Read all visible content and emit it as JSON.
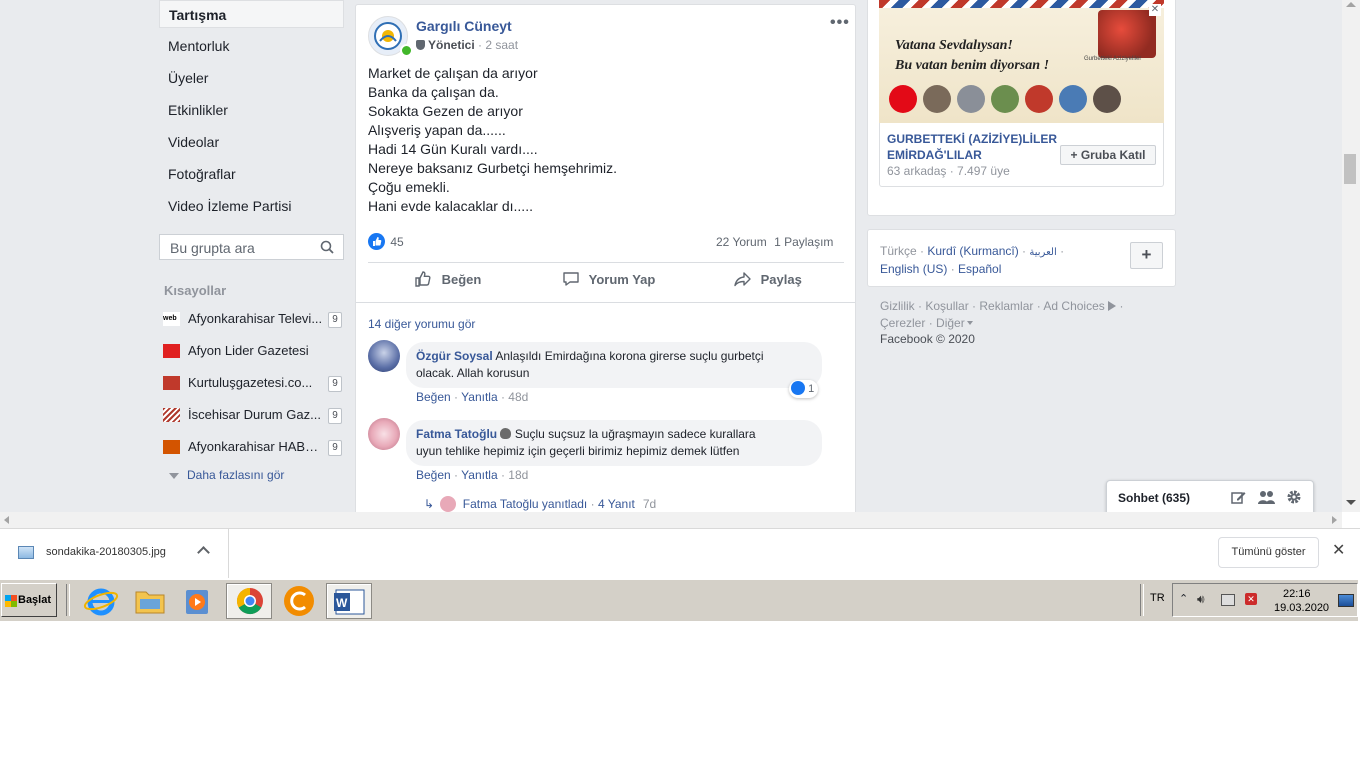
{
  "left_nav": {
    "items": [
      "Tartışma",
      "Mentorluk",
      "Üyeler",
      "Etkinlikler",
      "Videolar",
      "Fotoğraflar",
      "Video İzleme Partisi"
    ],
    "search_placeholder": "Bu grupta ara",
    "shortcuts_title": "Kısayollar",
    "shortcuts": [
      {
        "label": "Afyonkarahisar Televi...",
        "badge": "9",
        "color": "#000000"
      },
      {
        "label": "Afyon Lider Gazetesi",
        "badge": "9",
        "color": "#e02020"
      },
      {
        "label": "Kurtuluşgazetesi.co...",
        "badge": "9",
        "color": "#c0392b"
      },
      {
        "label": "İscehisar Durum Gaz...",
        "badge": "9",
        "color": "#b03a2e"
      },
      {
        "label": "Afyonkarahisar HABER",
        "badge": "9",
        "color": "#d35400"
      }
    ],
    "see_more": "Daha fazlasını gör"
  },
  "post": {
    "author": "Gargılı Cüneyt",
    "role": "Yönetici",
    "time": "2 saat",
    "lines": [
      "Market de çalışan da arıyor",
      "Banka da çalışan da.",
      "Sokakta Gezen de arıyor",
      "Alışveriş yapan da......",
      "Hadi 14 Gün Kuralı vardı....",
      "Nereye baksanız Gurbetçi hemşehrimiz.",
      "Çoğu emekli.",
      "Hani evde kalacaklar dı....."
    ],
    "likes": "45",
    "comments_count": "22 Yorum",
    "shares_count": "1 Paylaşım",
    "actions": {
      "like": "Beğen",
      "comment": "Yorum Yap",
      "share": "Paylaş"
    },
    "more_comments": "14 diğer yorumu gör",
    "comments": [
      {
        "author": "Özgür Soysal",
        "text1": "Anlaşıldı Emirdağına korona girerse suçlu gurbetçi",
        "text2": "olacak. Allah korusun",
        "like": "Beğen",
        "reply": "Yanıtla",
        "time": "48d",
        "reactions": "1"
      },
      {
        "author": "Fatma Tatoğlu",
        "text1": "Suçlu suçsuz la uğraşmayın sadece kurallara",
        "text2": "uyun tehlike hepimiz için geçerli birimiz hepimiz demek lütfen",
        "like": "Beğen",
        "reply": "Yanıtla",
        "time": "18d"
      }
    ],
    "reply_summary": {
      "text": "Fatma Tatoğlu yanıtladı",
      "count": "4 Yanıt",
      "time": "7d"
    }
  },
  "suggested_group": {
    "banner_line1": "Vatana Sevdalıysan!",
    "banner_line2": "Bu vatan benim diyorsan !",
    "banner_brand": "Gurbetteki Aziziyeliler",
    "name_line1": "GURBETTEKİ (AZİZİYE)LİLER",
    "name_line2": "EMİRDAĞ'LILAR",
    "friends": "63 arkadaş",
    "members": "7.497 üye",
    "join_label": "Gruba Katıl"
  },
  "languages": {
    "items": [
      "Türkçe",
      "Kurdî (Kurmancî)",
      "العربية",
      "English (US)",
      "Español"
    ],
    "add_label": "+"
  },
  "footer": {
    "links": [
      "Gizlilik",
      "Koşullar",
      "Reklamlar",
      "Ad Choices",
      "Çerezler",
      "Diğer"
    ],
    "copyright": "Facebook © 2020"
  },
  "chat": {
    "label": "Sohbet (635)"
  },
  "download_bar": {
    "file": "sondakika-20180305.jpg",
    "show_all": "Tümünü göster"
  },
  "taskbar": {
    "start": "Başlat",
    "lang": "TR",
    "time": "22:16",
    "date": "19.03.2020"
  },
  "colors": {
    "fb_blue": "#385898",
    "link": "#365899",
    "bg": "#e9ebee",
    "like_blue": "#1877f2"
  }
}
